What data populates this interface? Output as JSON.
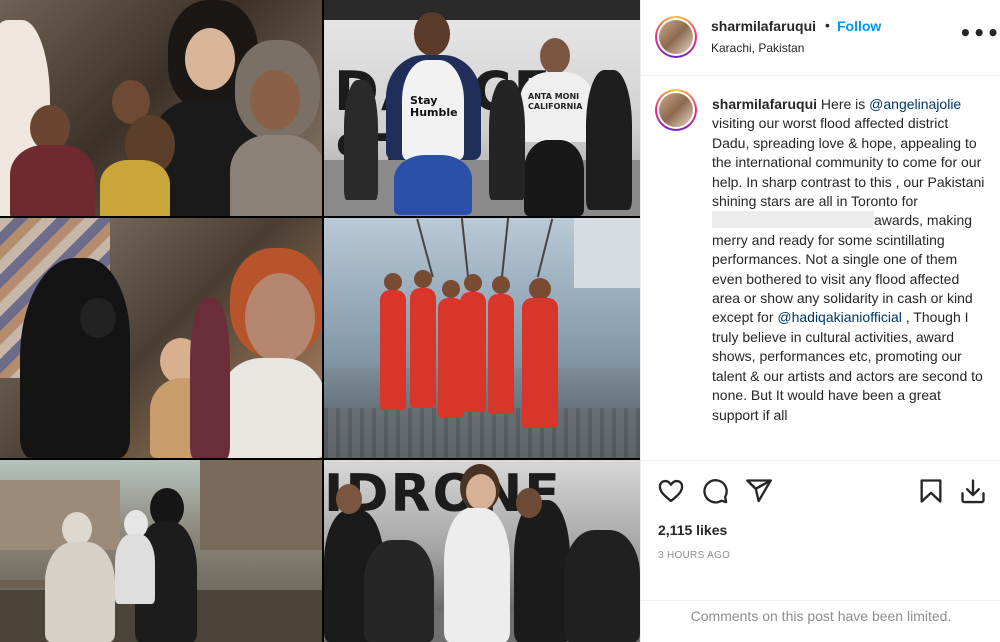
{
  "post": {
    "username": "sharmilafaruqui",
    "separator": "•",
    "follow_label": "Follow",
    "location": "Karachi, Pakistan",
    "more_options": "•••"
  },
  "caption": {
    "username": "sharmilafaruqui",
    "part1": " Here is ",
    "mention1": "@angelinajolie",
    "part2": " visiting our worst flood affected district Dadu, spreading love & hope, appealing to the international community to come for our help. In sharp contrast to this , our Pakistani shining stars are all in Toronto for ",
    "part3": "awards, making merry and ready for some scintillating performances. Not a single one of them even bothered to visit any flood affected area or show any solidarity in cash or kind except for ",
    "mention2": "@hadiqakianiofficial",
    "part4": " , Though I truly believe in cultural activities, award shows, performances etc, promoting our talent & our artists and actors are second to none. But It would have been a great support if all"
  },
  "studio_signs": {
    "top": "DANCE ST",
    "bottom": "IDRONE"
  },
  "shirt_text": {
    "left": "Stay Humble",
    "right": "ANTA MONI CALIFORNIA"
  },
  "actions": {
    "like_icon": "heart-icon",
    "comment_icon": "comment-icon",
    "share_icon": "send-icon",
    "save_icon": "bookmark-icon",
    "download_icon": "download-icon"
  },
  "stats": {
    "likes": "2,115 likes",
    "time_ago": "3 HOURS AGO"
  },
  "comments_notice": "Comments on this post have been limited.",
  "colors": {
    "link": "#0095f6",
    "mention": "#00376b",
    "muted": "#8e8e8e",
    "text": "#262626"
  }
}
